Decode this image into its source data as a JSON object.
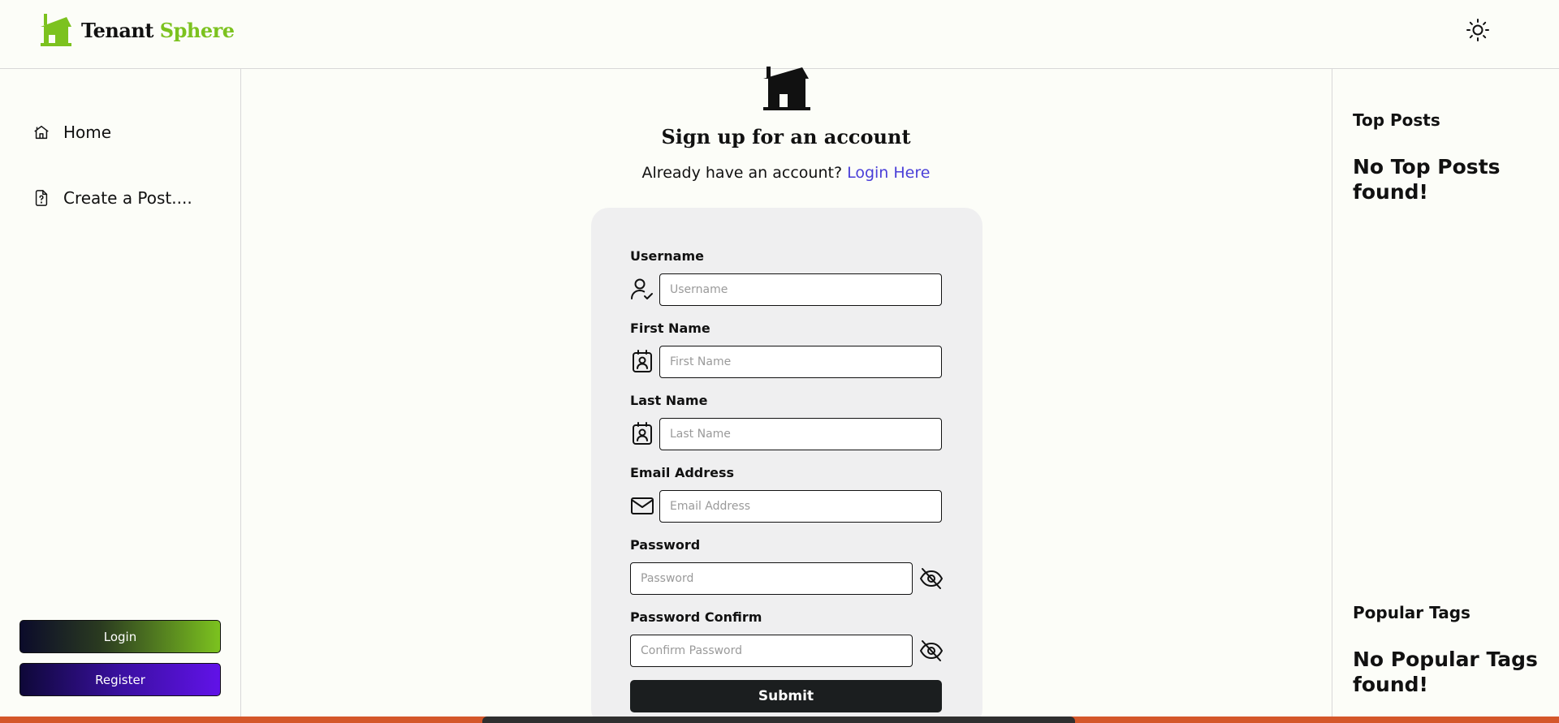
{
  "header": {
    "brand_part1": "Tenant",
    "brand_part2": " Sphere",
    "logo_icon": "house-icon",
    "theme_icon": "sun-icon"
  },
  "colors": {
    "brand_green": "#7cc21f",
    "link": "#4a3fd8",
    "register_purple": "#6112e8",
    "submit": "#1b1e1f"
  },
  "sidebar": {
    "items": [
      {
        "label": "Home",
        "icon": "home-icon"
      },
      {
        "label": "Create a Post....",
        "icon": "file-question-icon"
      }
    ],
    "login_label": "Login",
    "register_label": "Register"
  },
  "main": {
    "title": "Sign up for an account",
    "subtitle": "Already have an account?",
    "login_link": "Login Here"
  },
  "form": {
    "username": {
      "label": "Username",
      "placeholder": "Username",
      "icon": "user-check-icon"
    },
    "first_name": {
      "label": "First Name",
      "placeholder": "First Name",
      "icon": "contact-card-icon"
    },
    "last_name": {
      "label": "Last Name",
      "placeholder": "Last Name",
      "icon": "contact-card-icon"
    },
    "email": {
      "label": "Email Address",
      "placeholder": "Email Address",
      "icon": "mail-icon"
    },
    "password": {
      "label": "Password",
      "placeholder": "Password",
      "icon": "eye-off-icon"
    },
    "password_confirm": {
      "label": "Password Confirm",
      "placeholder": "Confirm Password",
      "icon": "eye-off-icon"
    },
    "submit_label": "Submit"
  },
  "right": {
    "top_posts_heading": "Top Posts",
    "top_posts_empty": "No Top Posts found!",
    "tags_heading": "Popular Tags",
    "tags_empty": "No Popular Tags found!"
  }
}
